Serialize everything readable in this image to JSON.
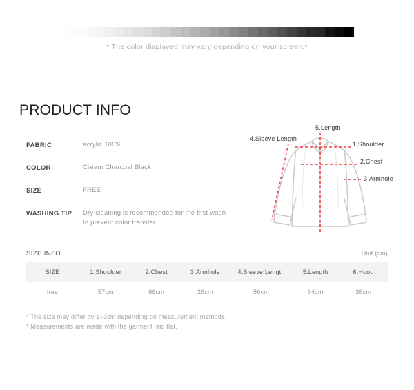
{
  "color_bar": {
    "disclaimer": "* The color displayed may vary depending on your screen.*",
    "swatches": [
      "#fdfdfd",
      "#fbfbfb",
      "#f8f8f8",
      "#f4f4f4",
      "#f0f0f0",
      "#ebebeb",
      "#e6e6e6",
      "#e0e0e0",
      "#dadada",
      "#d3d3d3",
      "#cccccc",
      "#c4c4c4",
      "#bcbcbc",
      "#b3b3b3",
      "#aaaaaa",
      "#a0a0a0",
      "#969696",
      "#8b8b8b",
      "#808080",
      "#747474",
      "#686868",
      "#5c5c5c",
      "#505050",
      "#434343",
      "#363636",
      "#2a2a2a",
      "#1e2a1e",
      "#141414",
      "#0a0a0a",
      "#000000"
    ]
  },
  "product_info": {
    "title": "PRODUCT INFO",
    "specs": [
      {
        "label": "FABRIC",
        "value": "acrylic 100%"
      },
      {
        "label": "COLOR",
        "value": "Cream Charcoal Black"
      },
      {
        "label": "SIZE",
        "value": "FREE"
      },
      {
        "label": "WASHING TIP",
        "value": "Dry cleaning is recommended for the first wash to prevent color transfer."
      }
    ]
  },
  "diagram": {
    "labels": {
      "length": "5.Length",
      "sleeve_length": "4.Sleeve Length",
      "shoulder": "1.Shoulder",
      "chest": "2.Chest",
      "armhole": "3.Armhole"
    },
    "colors": {
      "outline": "#c9c9c9",
      "measure_line": "#f4404a"
    }
  },
  "size_info": {
    "title": "SIZE INFO",
    "unit": "Unit (cm)",
    "columns": [
      "SIZE",
      "1.Shoulder",
      "2.Chest",
      "3.Armhole",
      "4.Sleeve Length",
      "5.Length",
      "6.Hood"
    ],
    "rows": [
      [
        "free",
        "57cm",
        "66cm",
        "26cm",
        "56cm",
        "64cm",
        "38cm"
      ]
    ],
    "notes": [
      "* The size may differ by 1~3cm depending on measurement methods.",
      "* Measurements are made with the garment laid flat."
    ]
  }
}
